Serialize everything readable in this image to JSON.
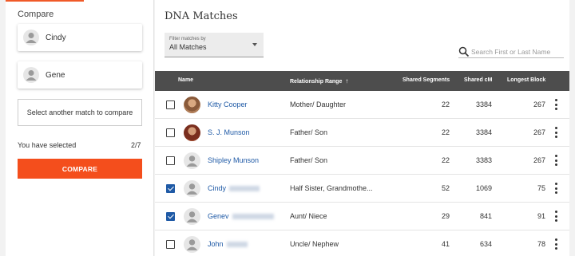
{
  "compare_panel": {
    "title": "Compare",
    "selected_matches": [
      {
        "name": "Cindy",
        "avatar": "person-silhouette-icon"
      },
      {
        "name": "Gene",
        "avatar": "person-silhouette-icon"
      }
    ],
    "select_prompt": "Select another match to compare",
    "selected_label": "You have selected",
    "selected_count": "2/7",
    "compare_button": "COMPARE"
  },
  "main": {
    "title": "DNA Matches",
    "filter": {
      "label": "Filter matches by",
      "value": "All Matches"
    },
    "search": {
      "placeholder": "Search First or Last Name",
      "icon": "search-icon"
    },
    "columns": {
      "name": "Name",
      "relationship": "Relationship Range",
      "segments": "Shared Segments",
      "cm": "Shared cM",
      "block": "Longest Block"
    },
    "rows": [
      {
        "name": "Kitty Cooper",
        "checked": false,
        "avatar": "photo",
        "relationship": "Mother/ Daughter",
        "segments": "22",
        "cm": "3384",
        "block": "267"
      },
      {
        "name": "S. J. Munson",
        "checked": false,
        "avatar": "photo",
        "relationship": "Father/ Son",
        "segments": "22",
        "cm": "3384",
        "block": "267"
      },
      {
        "name": "Shipley Munson",
        "checked": false,
        "avatar": "person-silhouette-icon",
        "relationship": "Father/ Son",
        "segments": "22",
        "cm": "3383",
        "block": "267"
      },
      {
        "name": "Cindy",
        "checked": true,
        "avatar": "person-silhouette-icon",
        "relationship": "Half Sister, Grandmothe...",
        "segments": "52",
        "cm": "1069",
        "block": "75"
      },
      {
        "name": "Genev",
        "checked": true,
        "avatar": "person-silhouette-icon",
        "relationship": "Aunt/ Niece",
        "segments": "29",
        "cm": "841",
        "block": "91"
      },
      {
        "name": "John",
        "checked": false,
        "avatar": "person-silhouette-icon",
        "relationship": "Uncle/ Nephew",
        "segments": "41",
        "cm": "634",
        "block": "78"
      }
    ]
  },
  "colors": {
    "accent": "#f44e1c",
    "link": "#1f5aa6",
    "header_bg": "#4d4d4d"
  }
}
